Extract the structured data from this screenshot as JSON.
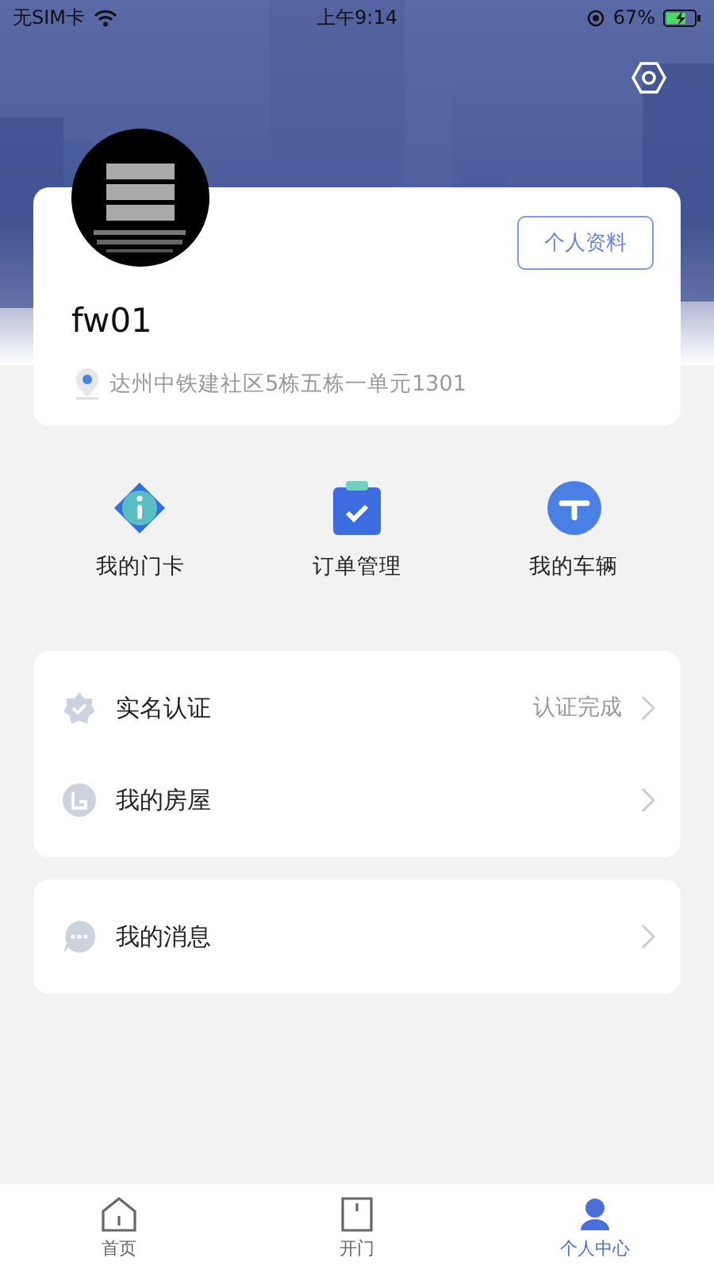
{
  "status_bar": {
    "carrier": "无SIM卡",
    "time": "上午9:14",
    "battery": "67%"
  },
  "header": {
    "kind": "picture"
  },
  "profile": {
    "username": "fw01",
    "address": "达州中铁建社区5栋五栋一单元1301",
    "profile_button": "个人资料"
  },
  "shortcuts": [
    {
      "kind": "card",
      "label": "我的门卡"
    },
    {
      "kind": "orders",
      "label": "订单管理"
    },
    {
      "kind": "vehicle",
      "label": "我的车辆"
    }
  ],
  "menu_groups": [
    [
      {
        "kind": "verify",
        "label": "实名认证",
        "value": "认证完成"
      },
      {
        "kind": "house",
        "label": "我的房屋"
      }
    ],
    [
      {
        "kind": "message",
        "label": "我的消息"
      }
    ]
  ],
  "tab_bar": [
    {
      "kind": "home",
      "label": "首页",
      "selected": false
    },
    {
      "kind": "door",
      "label": "开门",
      "selected": false
    },
    {
      "kind": "person",
      "label": "个人中心",
      "selected": true
    }
  ]
}
